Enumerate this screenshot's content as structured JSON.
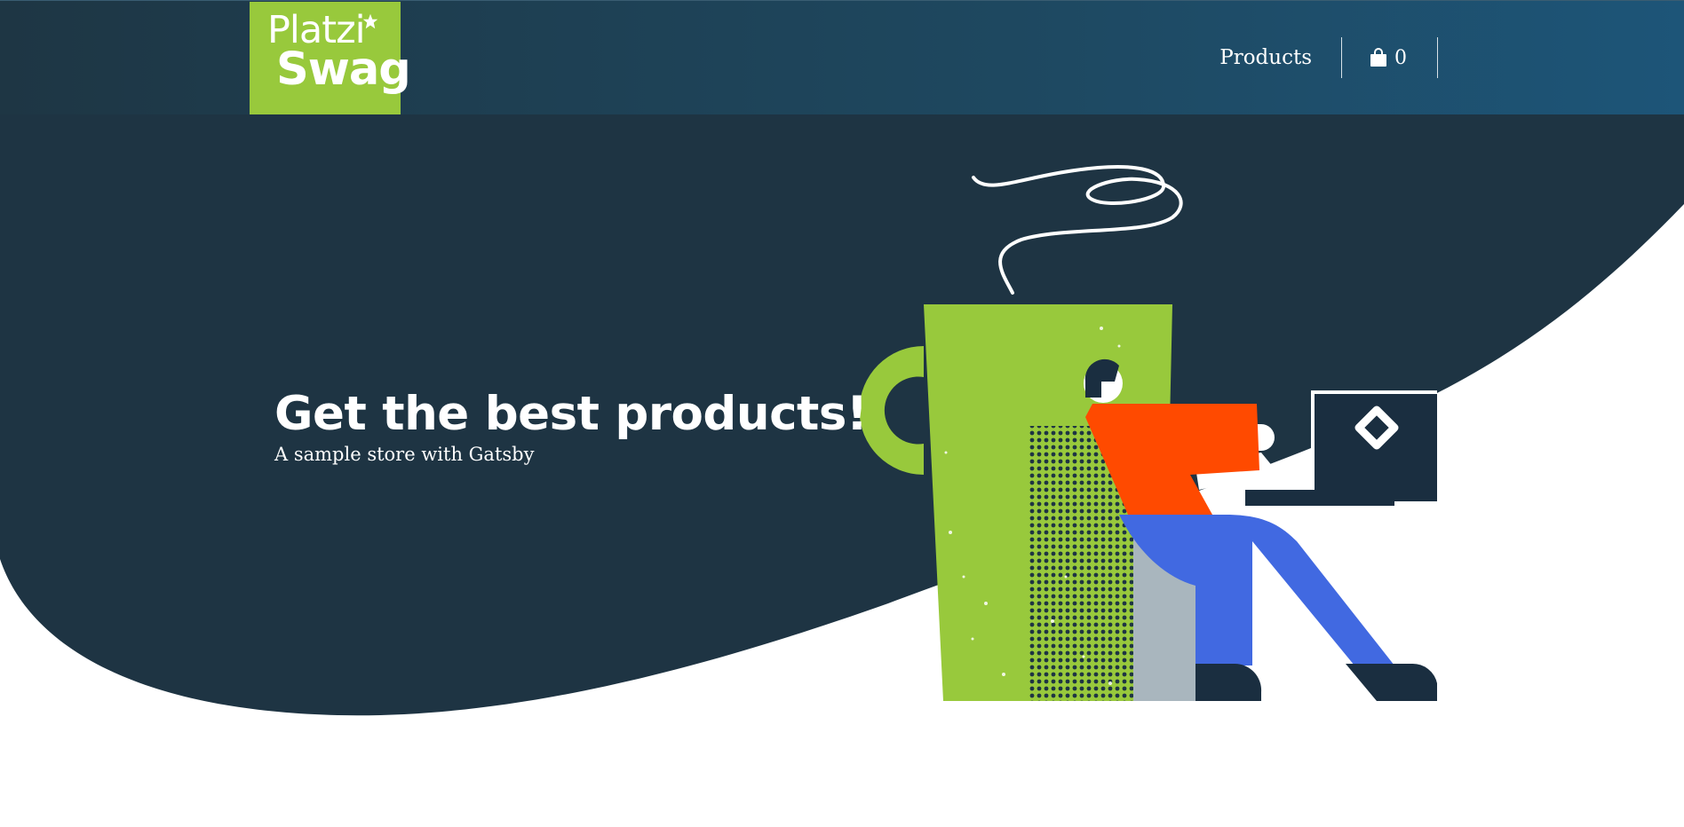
{
  "header": {
    "logo": {
      "line1": "Platzi",
      "line2": "Swag",
      "brand_color": "#98c93c"
    },
    "nav": {
      "products_label": "Products"
    },
    "cart": {
      "icon": "shopping-bag-icon",
      "count": "0"
    }
  },
  "hero": {
    "title": "Get the best products!",
    "subtitle": "A sample store with Gatsby",
    "background_color": "#1e3443"
  },
  "illustration": {
    "description_icon": "developer-with-coffee-mug-illustration",
    "colors": {
      "mug": "#98c93c",
      "shirt": "#ff4a00",
      "pants": "#4169e1",
      "laptop": "#1a2e40",
      "chair": "#a9b6be"
    }
  }
}
